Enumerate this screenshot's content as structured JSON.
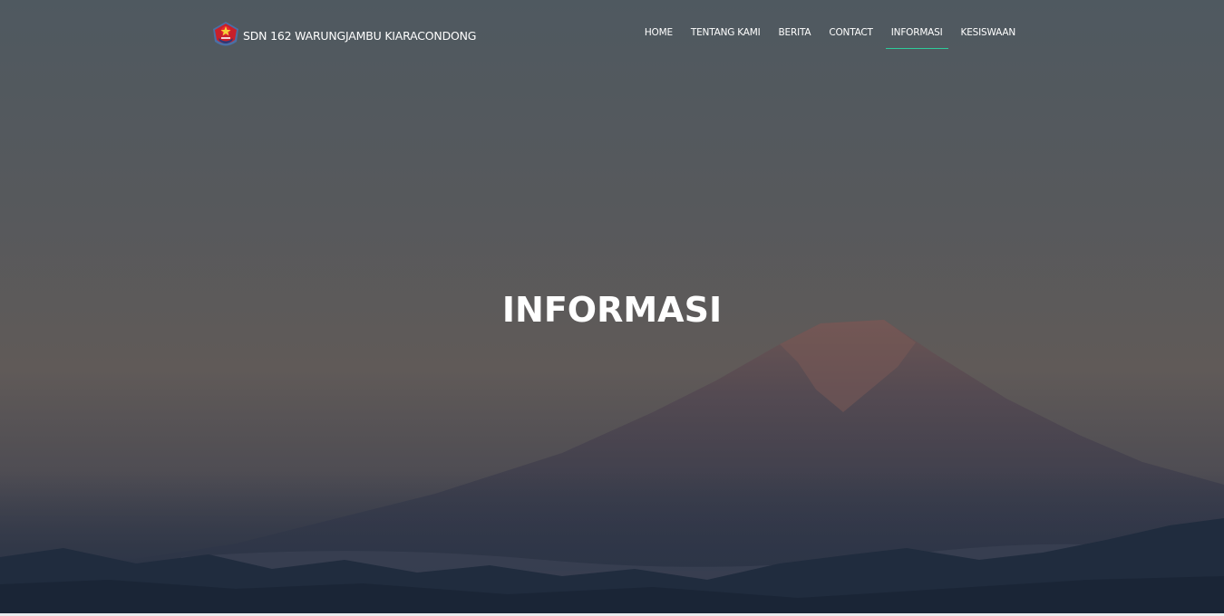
{
  "brand": {
    "name": "SDN 162 WARUNGJAMBU KIARACONDONG",
    "logo_icon": "school-emblem-icon"
  },
  "nav": {
    "items": [
      {
        "label": "HOME",
        "active": false
      },
      {
        "label": "TENTANG KAMI",
        "active": false
      },
      {
        "label": "BERITA",
        "active": false
      },
      {
        "label": "CONTACT",
        "active": false
      },
      {
        "label": "INFORMASI",
        "active": true
      },
      {
        "label": "KESISWAAN",
        "active": false
      }
    ],
    "active_indicator_color": "#2ecc9a"
  },
  "hero": {
    "title": "INFORMASI",
    "background": "mountain-sunrise-image"
  },
  "colors": {
    "text": "#ffffff",
    "sky_top": "#505a62",
    "sky_mid": "#625c58",
    "mountain": "#3a3d4a",
    "foothills": "#1e2b3e"
  }
}
